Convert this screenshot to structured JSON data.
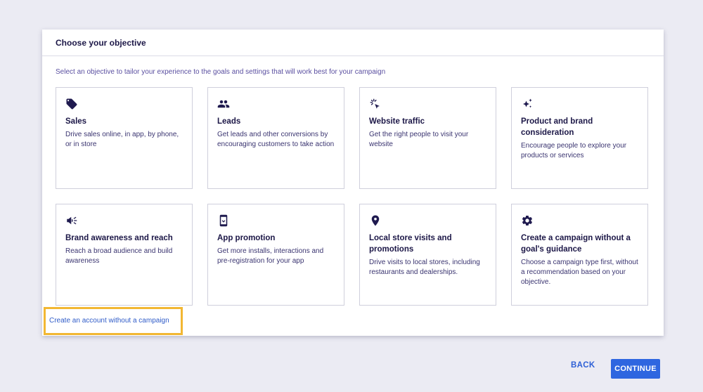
{
  "panel": {
    "title": "Choose your objective",
    "subtitle": "Select an objective to tailor your experience to the goals and settings that will work best for your campaign"
  },
  "objectives": [
    {
      "icon": "tag-icon",
      "title": "Sales",
      "desc": "Drive sales online, in app, by phone, or in store"
    },
    {
      "icon": "people-icon",
      "title": "Leads",
      "desc": "Get leads and other conversions by encouraging customers to take action"
    },
    {
      "icon": "cursor-click-icon",
      "title": "Website traffic",
      "desc": "Get the right people to visit your website"
    },
    {
      "icon": "sparkle-icon",
      "title": "Product and brand consideration",
      "desc": "Encourage people to explore your products or services"
    },
    {
      "icon": "megaphone-icon",
      "title": "Brand awareness and reach",
      "desc": "Reach a broad audience and build awareness"
    },
    {
      "icon": "phone-icon",
      "title": "App promotion",
      "desc": "Get more installs, interactions and pre-registration for your app"
    },
    {
      "icon": "location-pin-icon",
      "title": "Local store visits and promotions",
      "desc": "Drive visits to local stores, including restaurants and dealerships."
    },
    {
      "icon": "gear-icon",
      "title": "Create a campaign without a goal's guidance",
      "desc": "Choose a campaign type first, without a recommendation based on your objective."
    }
  ],
  "create_account_link": "Create an account without a campaign",
  "footer": {
    "back_label": "BACK",
    "continue_label": "CONTINUE"
  },
  "colors": {
    "accent": "#2e66e0",
    "highlight": "#f2b733",
    "icon": "#1f1a4f"
  }
}
